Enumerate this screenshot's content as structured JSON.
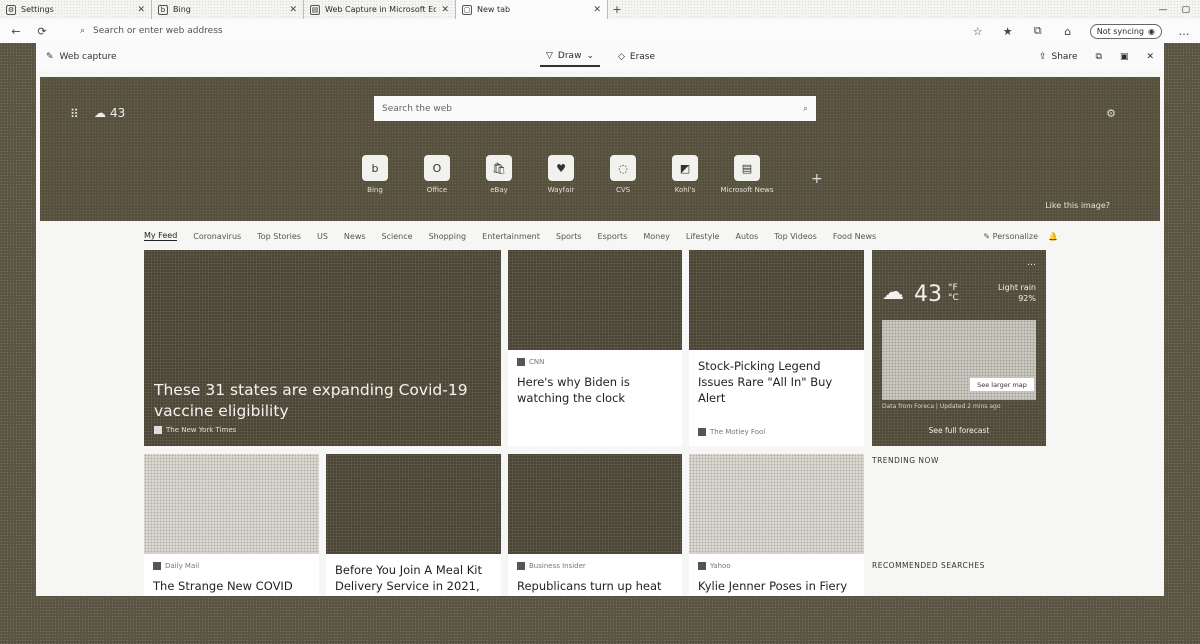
{
  "tabs": [
    {
      "title": "Settings",
      "icon": "gear-icon",
      "active": false
    },
    {
      "title": "Bing",
      "icon": "bing-icon",
      "active": false
    },
    {
      "title": "Web Capture in Microsoft Edge",
      "icon": "doc-icon",
      "active": false
    },
    {
      "title": "New tab",
      "icon": "newtab-icon",
      "active": true
    }
  ],
  "toolbar": {
    "address_placeholder": "Search or enter web address",
    "profile_label": "Not syncing"
  },
  "capture": {
    "title": "Web capture",
    "draw_label": "Draw",
    "erase_label": "Erase",
    "share_label": "Share"
  },
  "hero": {
    "temp": "43",
    "search_placeholder": "Search the web",
    "like_image": "Like this image?",
    "tiles": [
      {
        "label": "Bing",
        "glyph": "b"
      },
      {
        "label": "Office",
        "glyph": "O"
      },
      {
        "label": "eBay",
        "glyph": "🛍"
      },
      {
        "label": "Wayfair",
        "glyph": "♥"
      },
      {
        "label": "CVS",
        "glyph": "◌"
      },
      {
        "label": "Kohl's",
        "glyph": "◩"
      },
      {
        "label": "Microsoft News",
        "glyph": "▤"
      }
    ]
  },
  "feed": {
    "tabs": [
      "My Feed",
      "Coronavirus",
      "Top Stories",
      "US",
      "News",
      "Science",
      "Shopping",
      "Entertainment",
      "Sports",
      "Esports",
      "Money",
      "Lifestyle",
      "Autos",
      "Top Videos",
      "Food News"
    ],
    "personalize": "Personalize"
  },
  "cards": {
    "big": {
      "headline": "These 31 states are expanding Covid-19 vaccine eligibility",
      "source": "The New York Times"
    },
    "biden": {
      "headline": "Here's why Biden is watching the clock",
      "source": "CNN"
    },
    "stock": {
      "headline": "Stock-Picking Legend Issues Rare \"All In\" Buy Alert",
      "source": "The Motley Fool"
    },
    "covid2": {
      "headline": "The Strange New COVID",
      "source": "Daily Mail"
    },
    "mealkit": {
      "headline": "Before You Join A Meal Kit Delivery Service in 2021,",
      "source": ""
    },
    "republicans": {
      "headline": "Republicans turn up heat on",
      "source": "Business Insider"
    },
    "kylie": {
      "headline": "Kylie Jenner Poses in Fiery",
      "source": "Yahoo"
    }
  },
  "weather": {
    "temp": "43",
    "unit_f": "°F",
    "unit_c": "°C",
    "condition": "Light rain",
    "precip": "92%",
    "see_larger": "See larger map",
    "note": "Data from Foreca | Updated 2 mins ago",
    "forecast": "See full forecast"
  },
  "trending": {
    "title": "TRENDING NOW",
    "recommended": "RECOMMENDED SEARCHES"
  }
}
